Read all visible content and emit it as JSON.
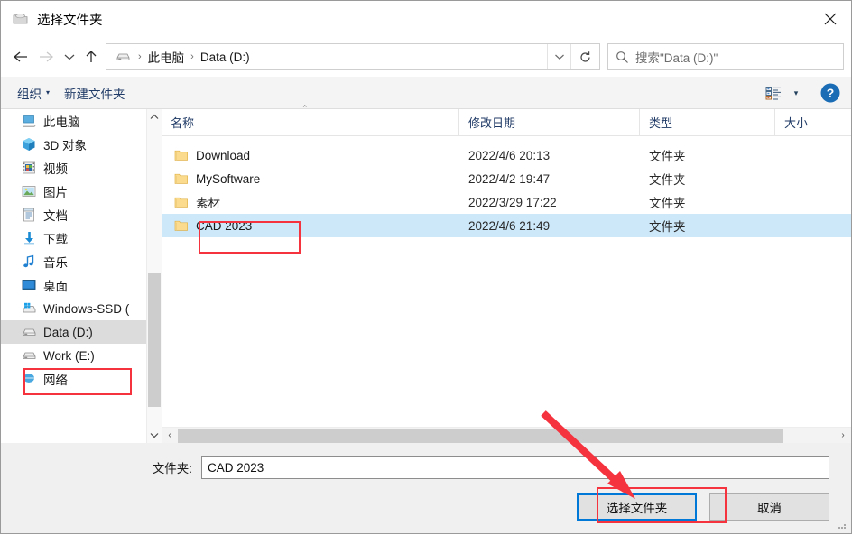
{
  "window": {
    "title": "选择文件夹",
    "title_icon": "folder-icon",
    "close_label": "✕"
  },
  "nav": {
    "back_label": "←",
    "forward_label": "→",
    "recent_label": "⌄",
    "up_label": "↑",
    "dropdown_label": "⌄",
    "refresh_label": "↻"
  },
  "address": {
    "drive_icon": "drive-icon",
    "separator": "›",
    "crumbs": [
      "此电脑",
      "Data (D:)"
    ]
  },
  "search": {
    "icon": "search-icon",
    "placeholder": "搜索\"Data (D:)\""
  },
  "toolbar": {
    "organize_label": "组织",
    "organize_caret": "▾",
    "new_folder_label": "新建文件夹",
    "view_icon": "list-view-icon",
    "view_caret": "▾",
    "help_label": "?"
  },
  "sidebar": {
    "scroll_up": "⌃",
    "scroll_down": "⌄",
    "items": [
      {
        "label": "此电脑",
        "icon": "computer-icon",
        "selected": false
      },
      {
        "label": "3D 对象",
        "icon": "3d-objects-icon",
        "selected": false
      },
      {
        "label": "视频",
        "icon": "videos-icon",
        "selected": false
      },
      {
        "label": "图片",
        "icon": "pictures-icon",
        "selected": false
      },
      {
        "label": "文档",
        "icon": "documents-icon",
        "selected": false
      },
      {
        "label": "下载",
        "icon": "downloads-icon",
        "selected": false
      },
      {
        "label": "音乐",
        "icon": "music-icon",
        "selected": false
      },
      {
        "label": "桌面",
        "icon": "desktop-icon",
        "selected": false
      },
      {
        "label": "Windows-SSD (",
        "icon": "drive-icon",
        "selected": false
      },
      {
        "label": "Data (D:)",
        "icon": "drive-icon",
        "selected": true
      },
      {
        "label": "Work (E:)",
        "icon": "drive-icon",
        "selected": false
      },
      {
        "label": "网络",
        "icon": "network-icon",
        "selected": false
      }
    ]
  },
  "filelist": {
    "columns": {
      "name": "名称",
      "date": "修改日期",
      "type": "类型",
      "size": "大小"
    },
    "sort_caret": "⌃",
    "rows": [
      {
        "name": "Download",
        "date": "2022/4/6 20:13",
        "type": "文件夹",
        "size": "",
        "icon": "folder-icon",
        "selected": false
      },
      {
        "name": "MySoftware",
        "date": "2022/4/2 19:47",
        "type": "文件夹",
        "size": "",
        "icon": "folder-icon",
        "selected": false
      },
      {
        "name": "素材",
        "date": "2022/3/29 17:22",
        "type": "文件夹",
        "size": "",
        "icon": "folder-icon",
        "selected": false
      },
      {
        "name": "CAD 2023",
        "date": "2022/4/6 21:49",
        "type": "文件夹",
        "size": "",
        "icon": "folder-icon",
        "selected": true
      }
    ],
    "hscroll_left": "‹",
    "hscroll_right": "›"
  },
  "footer": {
    "folder_label": "文件夹:",
    "folder_value": "CAD 2023",
    "select_button": "选择文件夹",
    "cancel_button": "取消"
  },
  "annotations": {
    "accent_color": "#f5333f",
    "focus_color": "#0078d7",
    "selection_color": "#cce8f9"
  }
}
